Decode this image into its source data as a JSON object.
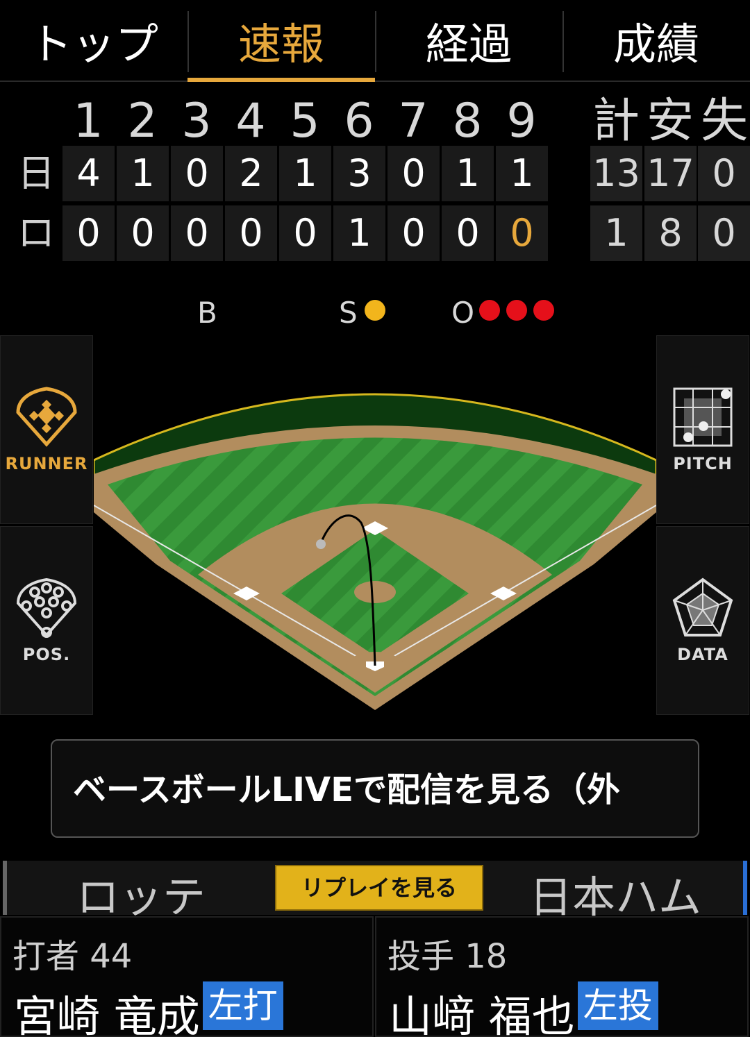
{
  "tabs": [
    {
      "label": "トップ"
    },
    {
      "label": "速報"
    },
    {
      "label": "経過"
    },
    {
      "label": "成績"
    }
  ],
  "scoreboard": {
    "innings": [
      "1",
      "2",
      "3",
      "4",
      "5",
      "6",
      "7",
      "8",
      "9"
    ],
    "total_headers": [
      "計",
      "安",
      "失"
    ],
    "rows": [
      {
        "label": "日",
        "innings": [
          "4",
          "1",
          "0",
          "2",
          "1",
          "3",
          "0",
          "1",
          "1"
        ],
        "totals": [
          "13",
          "17",
          "0"
        ]
      },
      {
        "label": "ロ",
        "innings": [
          "0",
          "0",
          "0",
          "0",
          "0",
          "1",
          "0",
          "0",
          "0"
        ],
        "totals": [
          "1",
          "8",
          "0"
        ]
      }
    ]
  },
  "count": {
    "balls_label": "B",
    "balls": 0,
    "strikes_label": "S",
    "strikes": 1,
    "outs_label": "O",
    "outs": 3
  },
  "side_buttons": {
    "runner": "RUNNER",
    "pos": "POS.",
    "pitch": "PITCH",
    "data": "DATA"
  },
  "live_button": "ベースボールLIVEで配信を見る（外",
  "teams": {
    "left": "ロッテ",
    "right": "日本ハム",
    "replay": "リプレイを見る"
  },
  "batter": {
    "role": "打者 44",
    "name": "宮崎 竜成",
    "hand": "左打"
  },
  "pitcher": {
    "role": "投手 18",
    "name": "山﨑 福也",
    "hand": "左投"
  },
  "colors": {
    "accent": "#e7a83c",
    "strike": "#f2b51c",
    "out": "#e5101a",
    "hand_badge": "#2a76d8"
  }
}
